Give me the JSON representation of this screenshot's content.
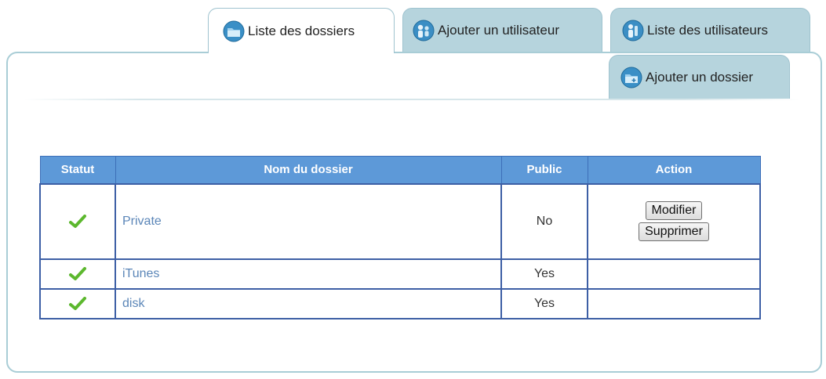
{
  "tabs": {
    "liste_dossiers": "Liste des dossiers",
    "ajouter_utilisateur": "Ajouter un utilisateur",
    "liste_utilisateurs": "Liste des utilisateurs",
    "ajouter_dossier": "Ajouter un dossier"
  },
  "table": {
    "headers": [
      "Statut",
      "Nom du dossier",
      "Public",
      "Action"
    ],
    "rows": [
      {
        "status_icon": "green-check-icon",
        "name": "Private",
        "public": "No",
        "actions": [
          "Modifier",
          "Supprimer"
        ]
      },
      {
        "status_icon": "green-check-icon",
        "name": "iTunes",
        "public": "Yes",
        "actions": []
      },
      {
        "status_icon": "green-check-icon",
        "name": "disk",
        "public": "Yes",
        "actions": []
      }
    ]
  },
  "colors": {
    "header_bg": "#5d99d8",
    "tab_inactive_bg": "#b6d4dd",
    "link_text": "#5b86b8",
    "check_green": "#5cb82e"
  },
  "icons": {
    "folder": "folder-icon",
    "user_add": "user-add-icon",
    "user_list": "user-list-icon",
    "folder_add": "folder-add-icon"
  }
}
